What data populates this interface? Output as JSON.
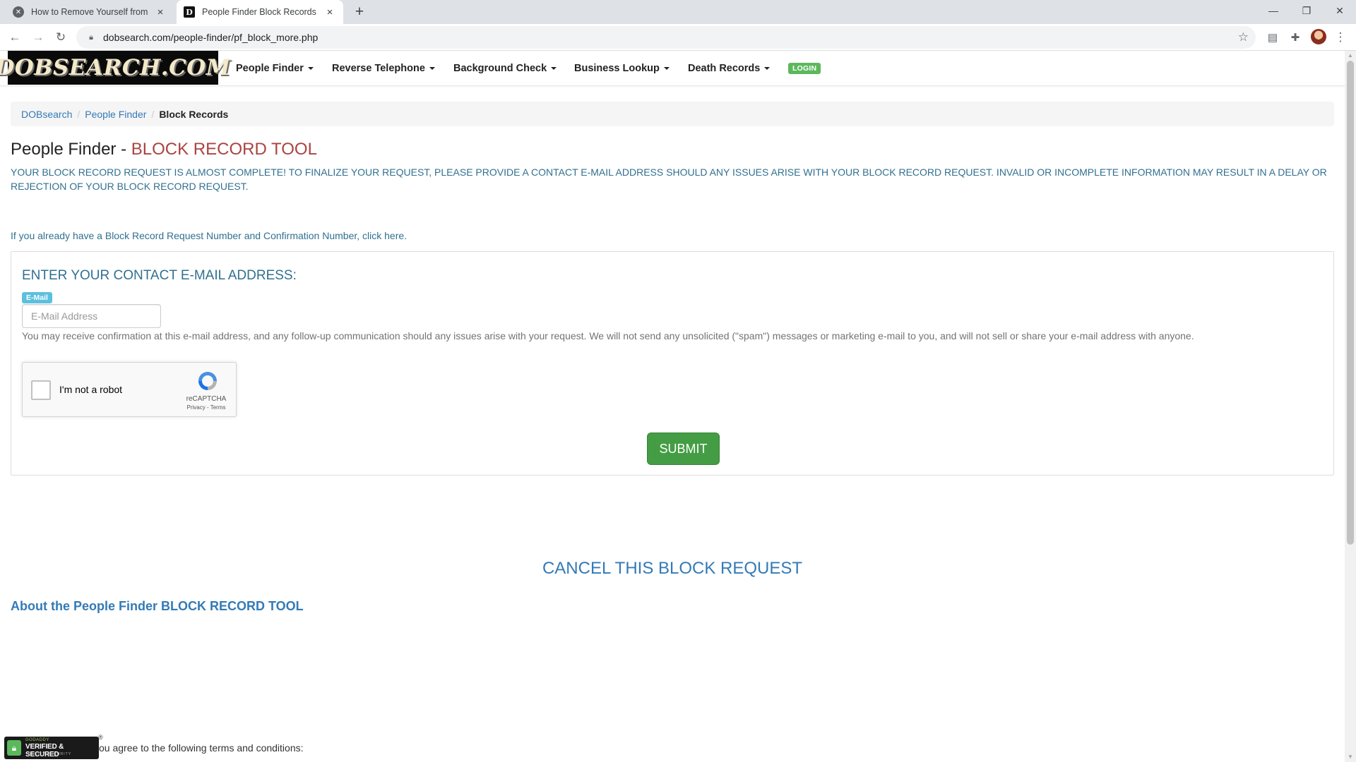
{
  "browser": {
    "tabs": [
      {
        "title": "How to Remove Yourself from DO",
        "active": false
      },
      {
        "title": "People Finder Block Records",
        "active": true
      }
    ],
    "new_tab": "+",
    "url": "dobsearch.com/people-finder/pf_block_more.php",
    "icons": {
      "back": "back-arrow-icon",
      "forward": "forward-arrow-icon",
      "reload": "reload-icon",
      "lock": "lock-icon",
      "bookmark": "star-icon",
      "reading_list": "reading-list-icon",
      "extensions": "puzzle-icon",
      "profile": "avatar",
      "menu": "kebab-menu-icon"
    }
  },
  "site": {
    "logo": "DOBSEARCH.COM",
    "nav": [
      {
        "label": "People Finder"
      },
      {
        "label": "Reverse Telephone"
      },
      {
        "label": "Background Check"
      },
      {
        "label": "Business Lookup"
      },
      {
        "label": "Death Records"
      }
    ],
    "login": "LOGIN"
  },
  "breadcrumb": {
    "items": [
      "DOBsearch",
      "People Finder"
    ],
    "current": "Block Records"
  },
  "page": {
    "title_prefix": "People Finder - ",
    "title_highlight": "BLOCK RECORD TOOL",
    "notice": "YOUR BLOCK RECORD REQUEST IS ALMOST COMPLETE! TO FINALIZE YOUR REQUEST, PLEASE PROVIDE A CONTACT E-MAIL ADDRESS SHOULD ANY ISSUES ARISE WITH YOUR BLOCK RECORD REQUEST. INVALID OR INCOMPLETE INFORMATION MAY RESULT IN A DELAY OR REJECTION OF YOUR BLOCK RECORD REQUEST.",
    "already_link": "If you already have a Block Record Request Number and Confirmation Number, click here."
  },
  "form": {
    "heading": "ENTER YOUR CONTACT E-MAIL ADDRESS:",
    "email_tag": "E-Mail",
    "email_placeholder": "E-Mail Address",
    "email_value": "",
    "help": "You may receive confirmation at this e-mail address, and any follow-up communication should any issues arise with your request. We will not send any unsolicited (\"spam\") messages or marketing e-mail to you, and will not sell or share your e-mail address with anyone.",
    "captcha": {
      "label": "I'm not a robot",
      "brand": "reCAPTCHA",
      "terms": "Privacy - Terms"
    },
    "submit": "SUBMIT"
  },
  "cancel": "CANCEL THIS BLOCK REQUEST",
  "about": "About the People Finder BLOCK RECORD TOOL",
  "footer": {
    "seal_top": "GODADDY",
    "seal_main": "VERIFIED & SECURED",
    "seal_sub": "VERIFY SECURITY",
    "reg": "®",
    "terms_text": "ou agree to the following terms and conditions:"
  },
  "colors": {
    "link": "#337ab7",
    "notice": "#31708f",
    "title_red": "#a94442",
    "submit_green": "#449d44",
    "badge_green": "#5cb85c",
    "tag_blue": "#5bc0de"
  }
}
